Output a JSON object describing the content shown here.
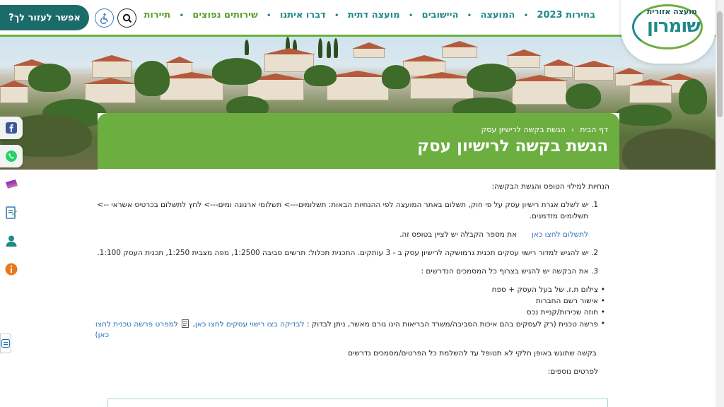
{
  "header": {
    "logo_top": "מועצה אזורית",
    "logo_main": "שומרון",
    "help_button": "אפשר לעזור לך?",
    "nav": [
      {
        "label": "בחירות 2023",
        "color": "#1f8a8a"
      },
      {
        "label": "המועצה",
        "color": "#1f8a8a"
      },
      {
        "label": "היישובים",
        "color": "#1f8a8a"
      },
      {
        "label": "מועצה דתית",
        "color": "#1f8a8a"
      },
      {
        "label": "דברו איתנו",
        "color": "#1f8a8a"
      },
      {
        "label": "שירותים נפוצים",
        "color": "#5a9e2c"
      },
      {
        "label": "תיירות",
        "color": "#5a9e2c"
      }
    ]
  },
  "breadcrumb": {
    "home": "דף הבית",
    "separator": "›",
    "current": "הגשת בקשה לרישיון עסק"
  },
  "page_title": "הגשת בקשה לרישיון עסק",
  "content": {
    "intro": "הנחיות למילוי הטופס והגשת הבקשה:",
    "step1_line1": "1. יש לשלם אגרת רישיון עסק על פי חוק, תשלום באתר המועצה לפי ההנחיות הבאות: תשלומים---> תשלומי ארנונה ומים---> לחץ לתשלום בכרטיס אשראי -->",
    "step1_line2": "תשלומים מזדמנים.",
    "step1_link": "לתשלום לחצו כאן",
    "step1_note": "את מספר הקבלה יש לציין בטופס זה.",
    "step2": "2. יש להגיש למדור רישוי עסקים תכנית גרמושקה לרישיון עסק ב - 3 עותקים.  התכנית תכלול: תרשים סביבה 1:2500, מפה מצבית 1:250, תכנית העסק 1:100.",
    "step3": "3. את הבקשה יש להגיש בצרוף כל המסמכים הנדרשים :",
    "bullets": [
      "צילום ת.ז. של בעל העסק + ספח",
      "אישור רשם החברות",
      "חוזה שכירות/קניית נכס"
    ],
    "bullet4_text": "פרשה טכנית (רק לעסקים בהם איכות הסביבה/משרד הבריאות הינו גורם מאשר, ניתן לבדוק :",
    "bullet4_link1": "לבדיקה בצו רישוי עסקים לחצו כאן,",
    "bullet4_link2": "למפרט פרשה טכנית לחצו",
    "bullet4_link3": "כאן)",
    "partial_note": "בקשה שתוגש באופן חלקי לא תטופל עד להשלמת כל הפרטים/מסמכים נדרשים",
    "more_details": "לפרטים נוספים:"
  },
  "icons": {
    "search": "search-icon",
    "accessibility": "accessibility-icon",
    "facebook": "facebook-icon",
    "whatsapp": "whatsapp-icon",
    "pdf": "pdf-icon"
  },
  "colors": {
    "brand_green": "#6cae3f",
    "brand_teal": "#1b6b6b",
    "link": "#2a6fb5"
  }
}
